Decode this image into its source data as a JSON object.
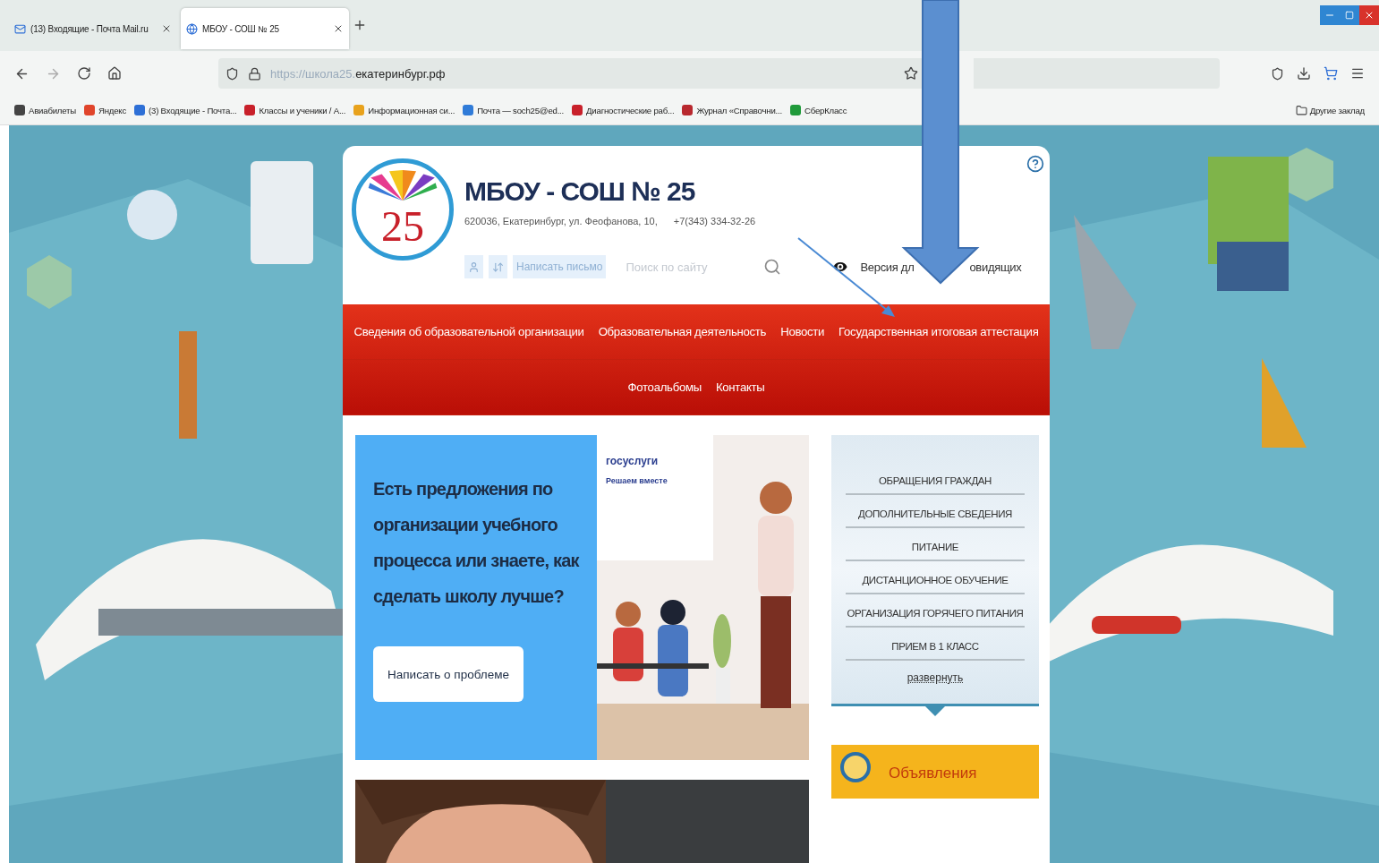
{
  "browser": {
    "tabs": [
      {
        "title": "(13) Входящие - Почта Mail.ru",
        "selected": false
      },
      {
        "title": "МБОУ - СОШ № 25",
        "selected": true
      }
    ],
    "url_scheme": "https://школа25.",
    "url_host": "екатеринбург.рф",
    "bookmarks": [
      {
        "label": "Авиабилеты",
        "color": "#444444"
      },
      {
        "label": "Яндекс",
        "color": "#e0452b"
      },
      {
        "label": "(3) Входящие - Почта...",
        "color": "#2d6fd6"
      },
      {
        "label": "Классы и ученики / А...",
        "color": "#c8202a"
      },
      {
        "label": "Информационная си...",
        "color": "#e8a21c"
      },
      {
        "label": "Почта — soch25@ed...",
        "color": "#2f7bd8"
      },
      {
        "label": "Диагностические раб...",
        "color": "#c8202a"
      },
      {
        "label": "Журнал «Справочни...",
        "color": "#b8282e"
      },
      {
        "label": "СберКласс",
        "color": "#1f9a3a"
      }
    ],
    "other_bookmarks": "Другие заклад"
  },
  "site": {
    "logo_number": "25",
    "title": "МБОУ - СОШ № 25",
    "address": "620036, Екатеринбург, ул. Феофанова, 10,",
    "phone": "+7(343) 334-32-26",
    "write_letter": "Написать письмо",
    "search_placeholder": "Поиск по сайту",
    "vision_start": "Версия дл",
    "vision_end": "овидящих",
    "nav": [
      [
        "Сведения об образовательной организации",
        "Образовательная деятельность",
        "Новости",
        "Государственная итоговая аттестация"
      ],
      [
        "Фотоальбомы",
        "Контакты"
      ]
    ],
    "banner": {
      "heading": "Есть предложения по организации учебного процесса или знаете, как сделать школу лучше?",
      "button": "Написать о проблеме",
      "brand": "госуслуги",
      "tagline": "Решаем вместе"
    },
    "side_menu": {
      "items": [
        "ОБРАЩЕНИЯ ГРАЖДАН",
        "ДОПОЛНИТЕЛЬНЫЕ СВЕДЕНИЯ",
        "ПИТАНИЕ",
        "ДИСТАНЦИОННОЕ ОБУЧЕНИЕ",
        "ОРГАНИЗАЦИЯ ГОРЯЧЕГО ПИТАНИЯ",
        "ПРИЕМ В 1 КЛАСС"
      ],
      "expand": "развернуть"
    },
    "announcements": "Объявления"
  }
}
